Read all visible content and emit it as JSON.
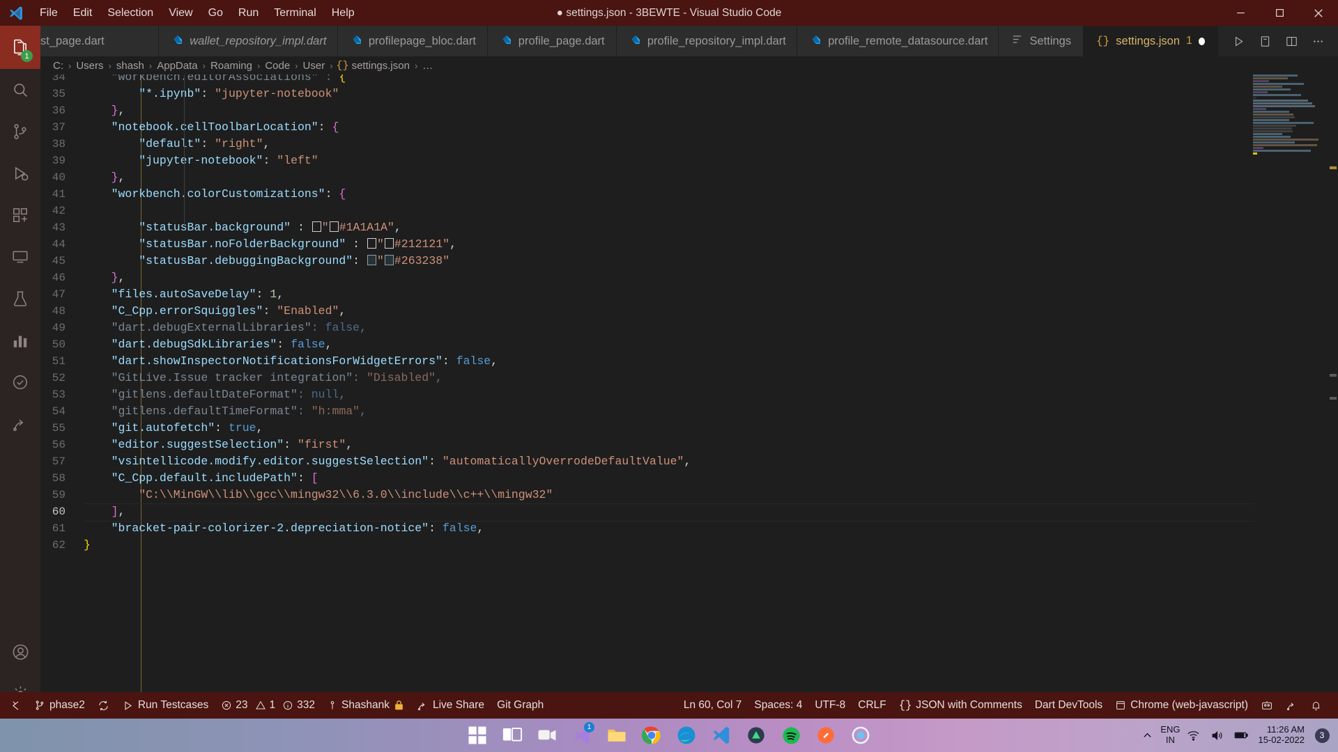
{
  "window": {
    "title": "● settings.json - 3BEWTE - Visual Studio Code",
    "menus": [
      "File",
      "Edit",
      "Selection",
      "View",
      "Go",
      "Run",
      "Terminal",
      "Help"
    ],
    "controls": {
      "minimize": "minimize-icon",
      "maximize": "maximize-icon",
      "close": "close-icon"
    }
  },
  "activity_bar": {
    "items": [
      {
        "name": "explorer",
        "icon": "files-icon",
        "badge": "1"
      },
      {
        "name": "search",
        "icon": "search-icon",
        "badge": ""
      },
      {
        "name": "source-control",
        "icon": "source-control-icon",
        "badge": ""
      },
      {
        "name": "run-and-debug",
        "icon": "run-debug-icon",
        "badge": ""
      },
      {
        "name": "extensions",
        "icon": "extensions-icon",
        "badge": ""
      },
      {
        "name": "remote-explorer",
        "icon": "remote-explorer-icon",
        "badge": ""
      },
      {
        "name": "testing",
        "icon": "beaker-icon",
        "badge": ""
      },
      {
        "name": "dart-devtools",
        "icon": "graph-icon",
        "badge": ""
      },
      {
        "name": "todo-tree",
        "icon": "checklist-icon",
        "badge": ""
      },
      {
        "name": "live-share",
        "icon": "live-share-icon",
        "badge": ""
      }
    ],
    "bottom_items": [
      {
        "name": "accounts",
        "icon": "account-icon",
        "badge": ""
      },
      {
        "name": "manage",
        "icon": "gear-icon",
        "badge": ""
      }
    ]
  },
  "tabs": [
    {
      "label": "st_page.dart",
      "icon": "dart-icon",
      "italic": false,
      "active": false,
      "truncated": true,
      "show_icon": false
    },
    {
      "label": "wallet_repository_impl.dart",
      "icon": "dart-icon",
      "italic": true,
      "active": false,
      "truncated": false,
      "show_icon": true
    },
    {
      "label": "profilepage_bloc.dart",
      "icon": "dart-icon",
      "italic": false,
      "active": false,
      "truncated": false,
      "show_icon": true
    },
    {
      "label": "profile_page.dart",
      "icon": "dart-icon",
      "italic": false,
      "active": false,
      "truncated": false,
      "show_icon": true
    },
    {
      "label": "profile_repository_impl.dart",
      "icon": "dart-icon",
      "italic": false,
      "active": false,
      "truncated": false,
      "show_icon": true
    },
    {
      "label": "profile_remote_datasource.dart",
      "icon": "dart-icon",
      "italic": false,
      "active": false,
      "truncated": false,
      "show_icon": true
    },
    {
      "label": "Settings",
      "icon": "settings-list-icon",
      "italic": false,
      "active": false,
      "truncated": false,
      "show_icon": true
    },
    {
      "label": "settings.json",
      "icon": "json-braces-icon",
      "italic": false,
      "active": true,
      "truncated": false,
      "show_icon": true,
      "count": "1",
      "dirty": true
    }
  ],
  "tab_actions": [
    {
      "name": "run-or-debug-button",
      "icon": "play-icon"
    },
    {
      "name": "split-editor-right-button",
      "icon": "split-editor-icon"
    },
    {
      "name": "toggle-panel-button",
      "icon": "layout-panel-icon"
    },
    {
      "name": "more-actions-button",
      "icon": "ellipsis-icon"
    }
  ],
  "breadcrumb": {
    "items": [
      "C:",
      "Users",
      "shash",
      "AppData",
      "Roaming",
      "Code",
      "User"
    ],
    "file": "settings.json",
    "file_icon": "json-braces-icon",
    "trailing": "…",
    "separator": "›"
  },
  "editor": {
    "first_visible_line": 34,
    "cursor_line": 60,
    "lines": [
      {
        "n": 34,
        "clipped": true,
        "tokens": [
          {
            "t": "    ",
            "c": "p"
          },
          {
            "t": "\"workbench.editorAssociations\"",
            "c": "kd"
          },
          {
            "t": " : ",
            "c": "pd"
          },
          {
            "t": "{",
            "c": "br2"
          }
        ]
      },
      {
        "n": 35,
        "tokens": [
          {
            "t": "        ",
            "c": "p"
          },
          {
            "t": "\"*.ipynb\"",
            "c": "k"
          },
          {
            "t": ": ",
            "c": "p"
          },
          {
            "t": "\"jupyter-notebook\"",
            "c": "s"
          }
        ]
      },
      {
        "n": 36,
        "tokens": [
          {
            "t": "    ",
            "c": "p"
          },
          {
            "t": "}",
            "c": "br1"
          },
          {
            "t": ",",
            "c": "p"
          }
        ]
      },
      {
        "n": 37,
        "tokens": [
          {
            "t": "    ",
            "c": "p"
          },
          {
            "t": "\"notebook.cellToolbarLocation\"",
            "c": "k"
          },
          {
            "t": ": ",
            "c": "p"
          },
          {
            "t": "{",
            "c": "br1"
          }
        ]
      },
      {
        "n": 38,
        "tokens": [
          {
            "t": "        ",
            "c": "p"
          },
          {
            "t": "\"default\"",
            "c": "k"
          },
          {
            "t": ": ",
            "c": "p"
          },
          {
            "t": "\"right\"",
            "c": "s"
          },
          {
            "t": ",",
            "c": "p"
          }
        ]
      },
      {
        "n": 39,
        "tokens": [
          {
            "t": "        ",
            "c": "p"
          },
          {
            "t": "\"jupyter-notebook\"",
            "c": "k"
          },
          {
            "t": ": ",
            "c": "p"
          },
          {
            "t": "\"left\"",
            "c": "s"
          }
        ]
      },
      {
        "n": 40,
        "tokens": [
          {
            "t": "    ",
            "c": "p"
          },
          {
            "t": "}",
            "c": "br1"
          },
          {
            "t": ",",
            "c": "p"
          }
        ]
      },
      {
        "n": 41,
        "tokens": [
          {
            "t": "    ",
            "c": "p"
          },
          {
            "t": "\"workbench.colorCustomizations\"",
            "c": "k"
          },
          {
            "t": ": ",
            "c": "p"
          },
          {
            "t": "{",
            "c": "br1"
          }
        ]
      },
      {
        "n": 42,
        "tokens": []
      },
      {
        "n": 43,
        "tokens": [
          {
            "t": "        ",
            "c": "p"
          },
          {
            "t": "\"statusBar.background\"",
            "c": "k"
          },
          {
            "t": " : ",
            "c": "p"
          },
          {
            "t": "@SW@",
            "c": "sw"
          },
          {
            "t": "\"",
            "c": "s"
          },
          {
            "t": "@SW@",
            "c": "sw"
          },
          {
            "t": "#1A1A1A\"",
            "c": "s"
          },
          {
            "t": ",",
            "c": "p"
          }
        ]
      },
      {
        "n": 44,
        "tokens": [
          {
            "t": "        ",
            "c": "p"
          },
          {
            "t": "\"statusBar.noFolderBackground\"",
            "c": "k"
          },
          {
            "t": " : ",
            "c": "p"
          },
          {
            "t": "@SW@",
            "c": "sw"
          },
          {
            "t": "\"",
            "c": "s"
          },
          {
            "t": "@SW@",
            "c": "sw"
          },
          {
            "t": "#212121\"",
            "c": "s"
          },
          {
            "t": ",",
            "c": "p"
          }
        ]
      },
      {
        "n": 45,
        "tokens": [
          {
            "t": "        ",
            "c": "p"
          },
          {
            "t": "\"statusBar.debuggingBackground\"",
            "c": "k"
          },
          {
            "t": ": ",
            "c": "p"
          },
          {
            "t": "@SWD@",
            "c": "sw"
          },
          {
            "t": "\"",
            "c": "s"
          },
          {
            "t": "@SWD@",
            "c": "sw"
          },
          {
            "t": "#263238\"",
            "c": "s"
          }
        ]
      },
      {
        "n": 46,
        "tokens": [
          {
            "t": "    ",
            "c": "p"
          },
          {
            "t": "}",
            "c": "br1"
          },
          {
            "t": ",",
            "c": "p"
          }
        ]
      },
      {
        "n": 47,
        "tokens": [
          {
            "t": "    ",
            "c": "p"
          },
          {
            "t": "\"files.autoSaveDelay\"",
            "c": "k"
          },
          {
            "t": ": ",
            "c": "p"
          },
          {
            "t": "1",
            "c": "n"
          },
          {
            "t": ",",
            "c": "p"
          }
        ]
      },
      {
        "n": 48,
        "tokens": [
          {
            "t": "    ",
            "c": "p"
          },
          {
            "t": "\"C_Cpp.errorSquiggles\"",
            "c": "k"
          },
          {
            "t": ": ",
            "c": "p"
          },
          {
            "t": "\"Enabled\"",
            "c": "s"
          },
          {
            "t": ",",
            "c": "p"
          }
        ]
      },
      {
        "n": 49,
        "tokens": [
          {
            "t": "    ",
            "c": "p"
          },
          {
            "t": "\"dart.debugExternalLibraries\"",
            "c": "kd"
          },
          {
            "t": ": ",
            "c": "pd"
          },
          {
            "t": "false",
            "c": "bd"
          },
          {
            "t": ",",
            "c": "pd"
          }
        ]
      },
      {
        "n": 50,
        "tokens": [
          {
            "t": "    ",
            "c": "p"
          },
          {
            "t": "\"dart.debugSdkLibraries\"",
            "c": "k"
          },
          {
            "t": ": ",
            "c": "p"
          },
          {
            "t": "false",
            "c": "b"
          },
          {
            "t": ",",
            "c": "p"
          }
        ]
      },
      {
        "n": 51,
        "tokens": [
          {
            "t": "    ",
            "c": "p"
          },
          {
            "t": "\"dart.showInspectorNotificationsForWidgetErrors\"",
            "c": "k"
          },
          {
            "t": ": ",
            "c": "p"
          },
          {
            "t": "false",
            "c": "b"
          },
          {
            "t": ",",
            "c": "p"
          }
        ]
      },
      {
        "n": 52,
        "tokens": [
          {
            "t": "    ",
            "c": "p"
          },
          {
            "t": "\"GitLive.Issue tracker integration\"",
            "c": "kd"
          },
          {
            "t": ": ",
            "c": "pd"
          },
          {
            "t": "\"Disabled\"",
            "c": "sd"
          },
          {
            "t": ",",
            "c": "pd"
          }
        ]
      },
      {
        "n": 53,
        "tokens": [
          {
            "t": "    ",
            "c": "p"
          },
          {
            "t": "\"gitlens.defaultDateFormat\"",
            "c": "kd"
          },
          {
            "t": ": ",
            "c": "pd"
          },
          {
            "t": "null",
            "c": "bd"
          },
          {
            "t": ",",
            "c": "pd"
          }
        ]
      },
      {
        "n": 54,
        "tokens": [
          {
            "t": "    ",
            "c": "p"
          },
          {
            "t": "\"gitlens.defaultTimeFormat\"",
            "c": "kd"
          },
          {
            "t": ": ",
            "c": "pd"
          },
          {
            "t": "\"h:mma\"",
            "c": "sd"
          },
          {
            "t": ",",
            "c": "pd"
          }
        ]
      },
      {
        "n": 55,
        "tokens": [
          {
            "t": "    ",
            "c": "p"
          },
          {
            "t": "\"git.autofetch\"",
            "c": "k"
          },
          {
            "t": ": ",
            "c": "p"
          },
          {
            "t": "true",
            "c": "b"
          },
          {
            "t": ",",
            "c": "p"
          }
        ]
      },
      {
        "n": 56,
        "tokens": [
          {
            "t": "    ",
            "c": "p"
          },
          {
            "t": "\"editor.suggestSelection\"",
            "c": "k"
          },
          {
            "t": ": ",
            "c": "p"
          },
          {
            "t": "\"first\"",
            "c": "s"
          },
          {
            "t": ",",
            "c": "p"
          }
        ]
      },
      {
        "n": 57,
        "tokens": [
          {
            "t": "    ",
            "c": "p"
          },
          {
            "t": "\"vsintellicode.modify.editor.suggestSelection\"",
            "c": "k"
          },
          {
            "t": ": ",
            "c": "p"
          },
          {
            "t": "\"automaticallyOverrodeDefaultValue\"",
            "c": "s"
          },
          {
            "t": ",",
            "c": "p"
          }
        ]
      },
      {
        "n": 58,
        "tokens": [
          {
            "t": "    ",
            "c": "p"
          },
          {
            "t": "\"C_Cpp.default.includePath\"",
            "c": "k"
          },
          {
            "t": ": ",
            "c": "p"
          },
          {
            "t": "[",
            "c": "br1"
          }
        ]
      },
      {
        "n": 59,
        "tokens": [
          {
            "t": "        ",
            "c": "p"
          },
          {
            "t": "\"C:\\\\MinGW\\\\lib\\\\gcc\\\\mingw32\\\\6.3.0\\\\include\\\\c++\\\\mingw32\"",
            "c": "s"
          }
        ]
      },
      {
        "n": 60,
        "cursor": true,
        "tokens": [
          {
            "t": "    ",
            "c": "p"
          },
          {
            "t": "]",
            "c": "br1"
          },
          {
            "t": ",",
            "c": "p"
          }
        ]
      },
      {
        "n": 61,
        "tokens": [
          {
            "t": "    ",
            "c": "p"
          },
          {
            "t": "\"bracket-pair-colorizer-2.depreciation-notice\"",
            "c": "k"
          },
          {
            "t": ": ",
            "c": "p"
          },
          {
            "t": "false",
            "c": "b"
          },
          {
            "t": ",",
            "c": "p"
          }
        ]
      },
      {
        "n": 62,
        "tokens": [
          {
            "t": "}",
            "c": "br2"
          }
        ]
      }
    ]
  },
  "status_bar": {
    "left": [
      {
        "name": "remote-indicator",
        "icon": "remote-icon",
        "label": ""
      },
      {
        "name": "branch",
        "icon": "git-branch-icon",
        "label": "phase2"
      },
      {
        "name": "sync-changes",
        "icon": "sync-icon",
        "label": ""
      },
      {
        "name": "run-testcases",
        "icon": "play-icon",
        "label": "Run Testcases"
      },
      {
        "name": "problems",
        "icon": "error-warning-info-icons",
        "label": "23  1  332",
        "errors": "23",
        "warnings": "1",
        "infos": "332"
      },
      {
        "name": "gitlive-user",
        "icon": "person-icon",
        "label": "Shashank",
        "lock": "lock-icon"
      },
      {
        "name": "live-share",
        "icon": "live-share-icon",
        "label": "Live Share"
      },
      {
        "name": "git-graph",
        "icon": "",
        "label": "Git Graph"
      }
    ],
    "right": [
      {
        "name": "cursor-position",
        "icon": "",
        "label": "Ln 60, Col 7"
      },
      {
        "name": "indentation",
        "icon": "",
        "label": "Spaces: 4"
      },
      {
        "name": "encoding",
        "icon": "",
        "label": "UTF-8"
      },
      {
        "name": "eol",
        "icon": "",
        "label": "CRLF"
      },
      {
        "name": "language-mode",
        "icon": "json-braces-icon",
        "label": "JSON with Comments"
      },
      {
        "name": "dart-devtools",
        "icon": "",
        "label": "Dart DevTools"
      },
      {
        "name": "debug-target",
        "icon": "device-icon",
        "label": "Chrome (web-javascript)"
      },
      {
        "name": "live-share-session",
        "icon": "live-share-session-icon",
        "label": ""
      },
      {
        "name": "account",
        "icon": "account-icon",
        "label": ""
      },
      {
        "name": "notifications",
        "icon": "bell-icon",
        "label": ""
      }
    ]
  },
  "taskbar": {
    "items": [
      {
        "name": "start-button",
        "icon": "windows-icon",
        "badge": ""
      },
      {
        "name": "task-view-button",
        "icon": "task-view-icon",
        "badge": ""
      },
      {
        "name": "microsoft-teams",
        "icon": "teams-icon",
        "badge": ""
      },
      {
        "name": "visual-studio",
        "icon": "visual-studio-icon",
        "badge": "1"
      },
      {
        "name": "file-explorer",
        "icon": "folder-icon",
        "badge": ""
      },
      {
        "name": "google-chrome",
        "icon": "chrome-icon",
        "badge": ""
      },
      {
        "name": "microsoft-edge",
        "icon": "edge-icon",
        "badge": ""
      },
      {
        "name": "visual-studio-code",
        "icon": "vscode-icon",
        "badge": ""
      },
      {
        "name": "android-studio",
        "icon": "android-studio-icon",
        "badge": ""
      },
      {
        "name": "spotify",
        "icon": "spotify-icon",
        "badge": ""
      },
      {
        "name": "postman",
        "icon": "postman-icon",
        "badge": ""
      },
      {
        "name": "cortana",
        "icon": "cortana-icon",
        "badge": ""
      }
    ],
    "tray": {
      "expand_icon": "chevron-up-icon",
      "language": {
        "line1": "ENG",
        "line2": "IN"
      },
      "network_icon": "wifi-icon",
      "volume_icon": "speaker-icon",
      "battery_icon": "battery-icon",
      "time": "11:26 AM",
      "date": "15-02-2022",
      "notification_count": "3"
    }
  }
}
